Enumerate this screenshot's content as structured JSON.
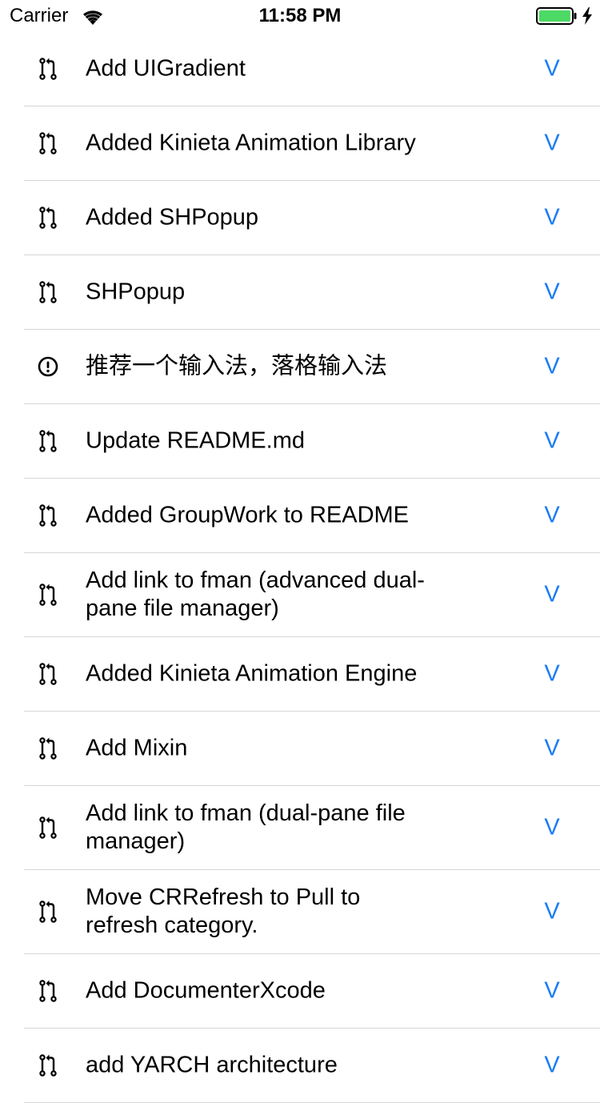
{
  "status_bar": {
    "carrier": "Carrier",
    "time": "11:58 PM",
    "wifi_icon": "wifi-icon",
    "battery_icon": "battery-icon",
    "charging_icon": "bolt-icon",
    "battery_color": "#4cd964"
  },
  "accent_color": "#1a7cf5",
  "rows": [
    {
      "icon": "pull-request-icon",
      "title": "Add UIGradient",
      "action": "V"
    },
    {
      "icon": "pull-request-icon",
      "title": "Added Kinieta Animation Library",
      "action": "V"
    },
    {
      "icon": "pull-request-icon",
      "title": "Added SHPopup",
      "action": "V"
    },
    {
      "icon": "pull-request-icon",
      "title": "SHPopup",
      "action": "V"
    },
    {
      "icon": "issue-icon",
      "title": "推荐一个输入法，落格输入法",
      "action": "V"
    },
    {
      "icon": "pull-request-icon",
      "title": "Update README.md",
      "action": "V"
    },
    {
      "icon": "pull-request-icon",
      "title": "Added GroupWork to README",
      "action": "V"
    },
    {
      "icon": "pull-request-icon",
      "title": "Add link to fman (advanced dual-pane file manager)",
      "action": "V"
    },
    {
      "icon": "pull-request-icon",
      "title": "Added Kinieta Animation Engine",
      "action": "V"
    },
    {
      "icon": "pull-request-icon",
      "title": "Add Mixin",
      "action": "V"
    },
    {
      "icon": "pull-request-icon",
      "title": "Add link to fman (dual-pane file manager)",
      "action": "V"
    },
    {
      "icon": "pull-request-icon",
      "title": "Move CRRefresh to Pull to refresh category.",
      "action": "V"
    },
    {
      "icon": "pull-request-icon",
      "title": "Add DocumenterXcode",
      "action": "V"
    },
    {
      "icon": "pull-request-icon",
      "title": "add YARCH architecture",
      "action": "V"
    }
  ]
}
